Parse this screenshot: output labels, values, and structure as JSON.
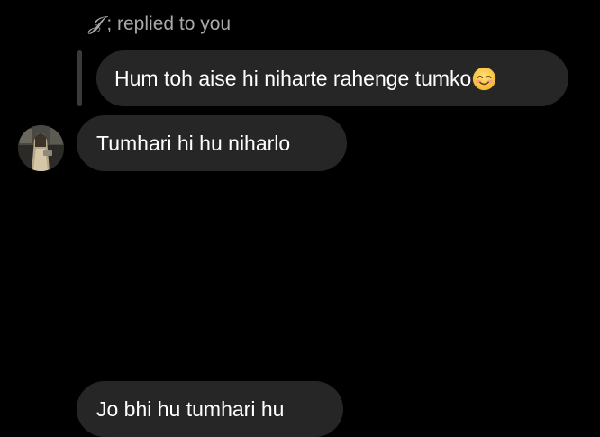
{
  "reply_header": {
    "name": "𝓙",
    "text": "; replied to you"
  },
  "quoted_message": {
    "text": "Hum toh aise hi niharte rahenge tumko",
    "emoji": "smiling-face-icon"
  },
  "messages": [
    {
      "text": "Tumhari hi hu niharlo"
    },
    {
      "text": "Jo bhi hu tumhari hu"
    }
  ],
  "colors": {
    "background": "#000000",
    "bubble": "#262626",
    "reply_bar": "#3a3a3c",
    "secondary_text": "#a8a8a8"
  }
}
